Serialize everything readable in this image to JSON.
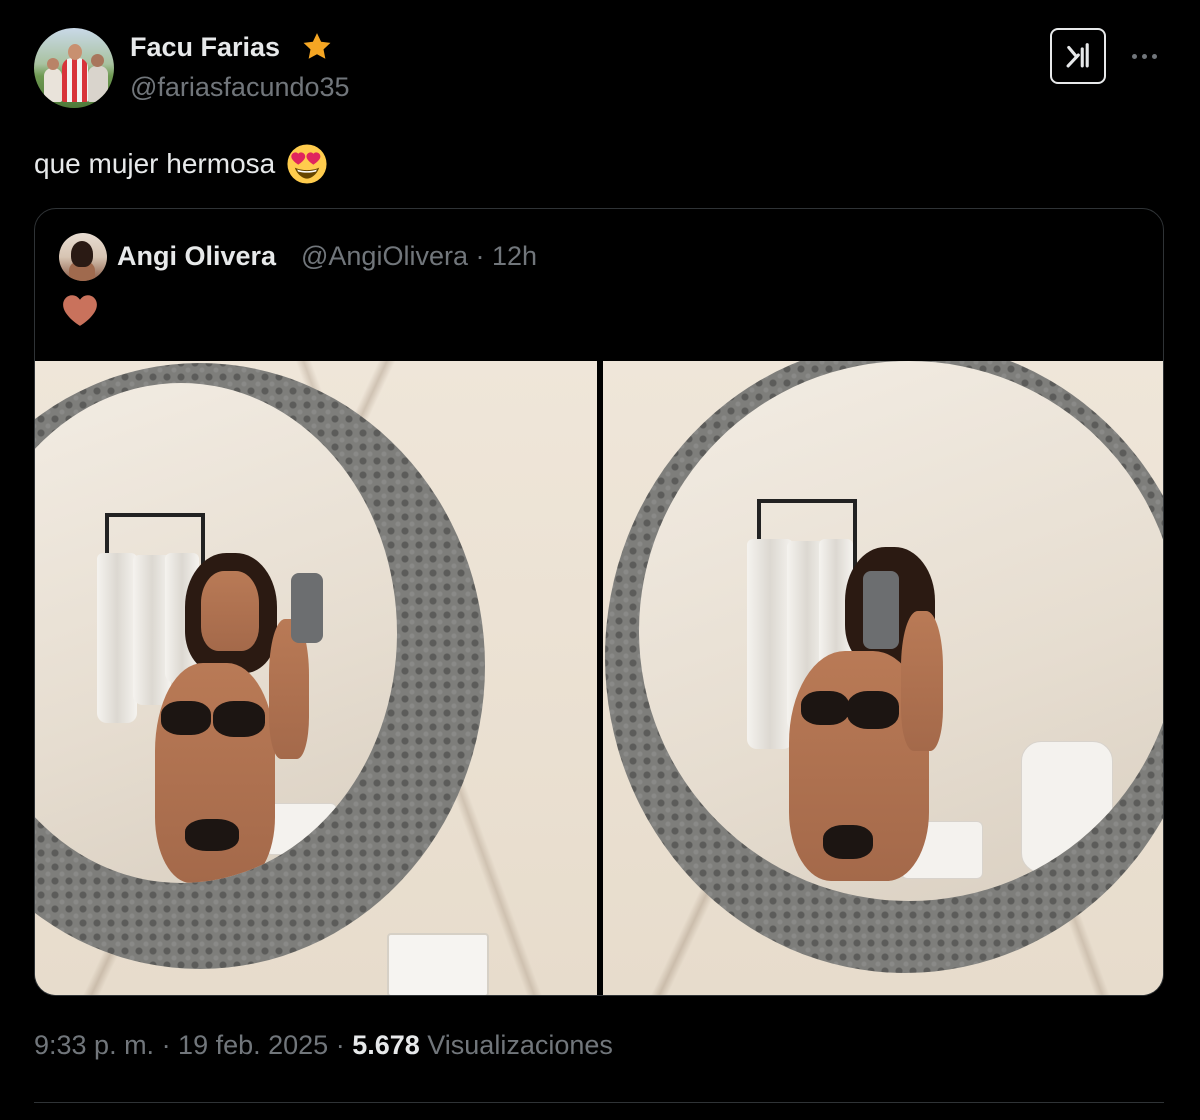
{
  "tweet": {
    "author": {
      "display_name": "Facu Farias",
      "handle": "@fariasfacundo35",
      "badge_icon": "star-icon",
      "badge_color": "#f5a623"
    },
    "text": "que mujer hermosa",
    "emoji": "smiling-face-with-heart-eyes-icon",
    "actions": {
      "grok_icon": "grok-icon",
      "more_icon": "more-icon"
    },
    "quoted": {
      "display_name": "Angi Olivera",
      "handle_time": "@AngiOlivera · 12h",
      "text_icon": "heart-icon",
      "heart_color": "#c9725c",
      "media_count": 2
    },
    "meta": {
      "time_date": "9:33 p. m. · 19 feb. 2025 · ",
      "views_count": "5.678",
      "views_label": " Visualizaciones"
    }
  },
  "colors": {
    "background": "#000000",
    "text_primary": "#e7e9ea",
    "text_secondary": "#71767b",
    "border": "#2f3336"
  }
}
